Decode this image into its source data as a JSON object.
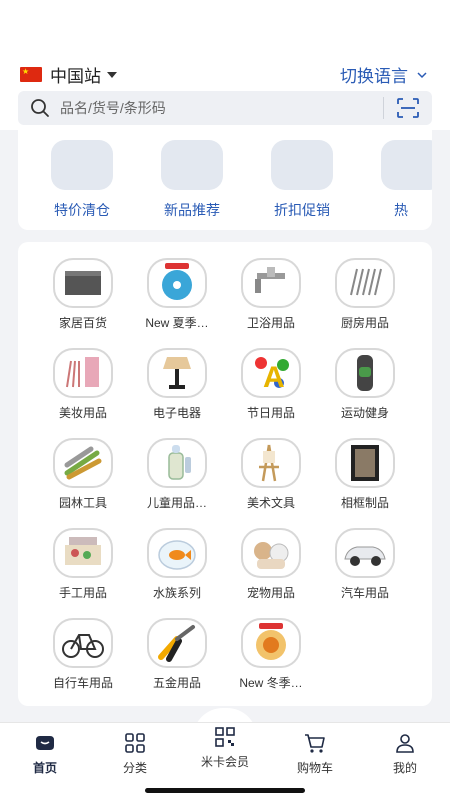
{
  "header": {
    "station": "中国站",
    "language": "切换语言",
    "search_placeholder": "品名/货号/条形码"
  },
  "promos": [
    {
      "label": "特价清仓"
    },
    {
      "label": "新品推荐"
    },
    {
      "label": "折扣促销"
    },
    {
      "label": "热"
    }
  ],
  "categories": [
    {
      "label": "家居百货",
      "icon": "storage-box-icon"
    },
    {
      "label": "New 夏季…",
      "icon": "fan-icon"
    },
    {
      "label": "卫浴用品",
      "icon": "faucet-icon"
    },
    {
      "label": "厨房用品",
      "icon": "utensils-icon"
    },
    {
      "label": "美妆用品",
      "icon": "brushes-icon"
    },
    {
      "label": "电子电器",
      "icon": "lamp-icon"
    },
    {
      "label": "节日用品",
      "icon": "balloon-icon"
    },
    {
      "label": "运动健身",
      "icon": "knee-brace-icon"
    },
    {
      "label": "园林工具",
      "icon": "garden-tools-icon"
    },
    {
      "label": "儿童用品…",
      "icon": "baby-bottle-icon"
    },
    {
      "label": "美术文具",
      "icon": "easel-icon"
    },
    {
      "label": "相框制品",
      "icon": "photo-frame-icon"
    },
    {
      "label": "手工用品",
      "icon": "craft-kit-icon"
    },
    {
      "label": "水族系列",
      "icon": "fish-bowl-icon"
    },
    {
      "label": "宠物用品",
      "icon": "pets-icon"
    },
    {
      "label": "汽车用品",
      "icon": "car-icon"
    },
    {
      "label": "自行车用品",
      "icon": "bicycle-icon"
    },
    {
      "label": "五金用品",
      "icon": "pliers-icon"
    },
    {
      "label": "New 冬季…",
      "icon": "heater-icon"
    }
  ],
  "tabbar": [
    {
      "label": "首页",
      "icon": "home-icon",
      "active": true
    },
    {
      "label": "分类",
      "icon": "grid-icon",
      "active": false
    },
    {
      "label": "米卡会员",
      "icon": "qr-code-icon",
      "active": false
    },
    {
      "label": "购物车",
      "icon": "cart-icon",
      "active": false
    },
    {
      "label": "我的",
      "icon": "user-icon",
      "active": false
    }
  ],
  "colors": {
    "accent": "#2a5bb5",
    "background": "#f2f3f6",
    "promo_tile": "#e3e8f0"
  }
}
